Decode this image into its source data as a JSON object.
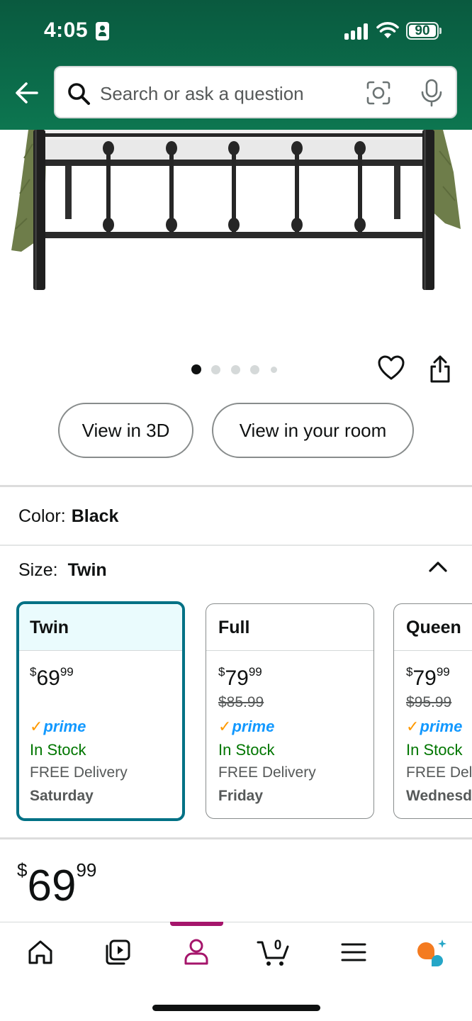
{
  "status_bar": {
    "time": "4:05",
    "battery": "90"
  },
  "search": {
    "placeholder": "Search or ask a question"
  },
  "gallery": {
    "image_count": 5,
    "active_index": 0
  },
  "view_buttons": {
    "view_3d": "View in 3D",
    "view_room": "View in your room"
  },
  "color": {
    "label": "Color:",
    "value": "Black"
  },
  "size": {
    "label": "Size:",
    "value": "Twin",
    "options": [
      {
        "name": "Twin",
        "currency": "$",
        "price_whole": "69",
        "price_fraction": "99",
        "list_price": "",
        "prime": "prime",
        "stock": "In Stock",
        "delivery": "FREE Delivery",
        "delivery_day": "Saturday"
      },
      {
        "name": "Full",
        "currency": "$",
        "price_whole": "79",
        "price_fraction": "99",
        "list_price": "$85.99",
        "prime": "prime",
        "stock": "In Stock",
        "delivery": "FREE Delivery",
        "delivery_day": "Friday"
      },
      {
        "name": "Queen",
        "currency": "$",
        "price_whole": "79",
        "price_fraction": "99",
        "list_price": "$95.99",
        "prime": "prime",
        "stock": "In Stock",
        "delivery": "FREE Delivery",
        "delivery_day": "Wednesday"
      }
    ]
  },
  "price": {
    "currency": "$",
    "whole": "69",
    "fraction": "99"
  },
  "tab_bar": {
    "cart_count": "0",
    "active_tab": "account",
    "tabs": [
      "home-icon",
      "video-icon",
      "account-icon",
      "cart-icon",
      "menu-icon",
      "rufus-icon"
    ]
  },
  "colors": {
    "header_green": "#0b6b4a",
    "selected_border": "#007185",
    "selected_bg": "#eafbfd",
    "in_stock": "#007600",
    "prime_blue": "#1399ff",
    "active_tab": "#a5156b"
  }
}
